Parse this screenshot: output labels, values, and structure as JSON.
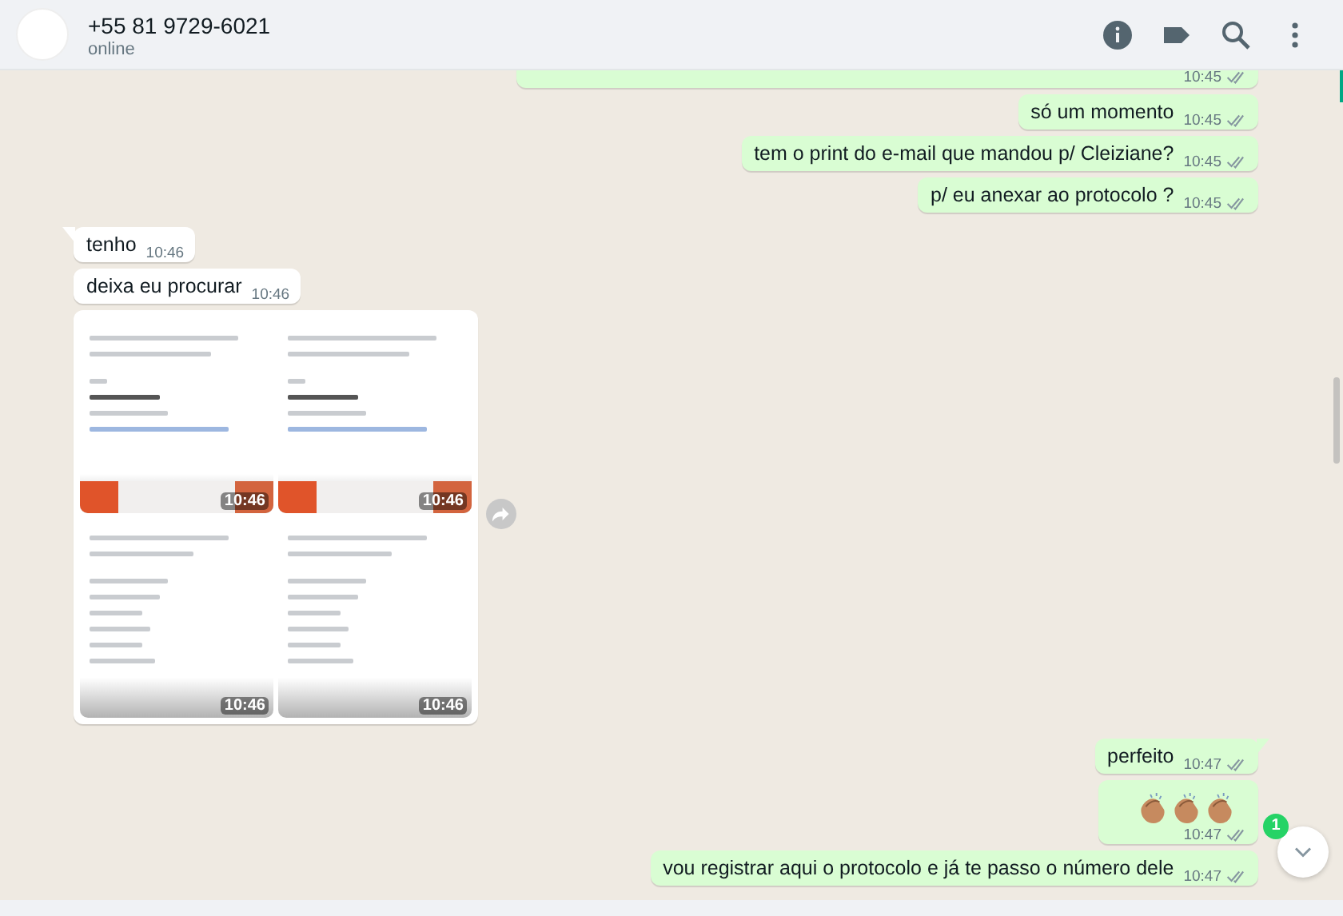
{
  "header": {
    "contact": "+55 81 9729-6021",
    "status": "online"
  },
  "messages": [
    {
      "kind": "cut",
      "outgoing": true,
      "time": "10:45",
      "read": false,
      "tail": false
    },
    {
      "kind": "text",
      "outgoing": true,
      "text": "só um momento",
      "time": "10:45",
      "read": false,
      "tail": false
    },
    {
      "kind": "text",
      "outgoing": true,
      "text": "tem o print do e-mail que mandou p/ Cleiziane?",
      "time": "10:45",
      "read": false,
      "tail": false
    },
    {
      "kind": "text",
      "outgoing": true,
      "text": "p/ eu anexar ao protocolo ?",
      "time": "10:45",
      "read": false,
      "tail": false
    },
    {
      "kind": "text",
      "outgoing": false,
      "text": "tenho",
      "time": "10:46",
      "tail": true
    },
    {
      "kind": "text",
      "outgoing": false,
      "text": "deixa eu procurar",
      "time": "10:46",
      "tail": false
    },
    {
      "kind": "images",
      "outgoing": false,
      "tail": false,
      "images": [
        {
          "kind": "banner",
          "time": "10:46"
        },
        {
          "kind": "banner",
          "time": "10:46"
        },
        {
          "kind": "table",
          "time": "10:46"
        },
        {
          "kind": "table",
          "time": "10:46"
        }
      ]
    },
    {
      "kind": "text",
      "outgoing": true,
      "text": "perfeito",
      "time": "10:47",
      "read": false,
      "tail": true
    },
    {
      "kind": "claps",
      "outgoing": true,
      "time": "10:47",
      "read": false,
      "tail": false
    },
    {
      "kind": "text",
      "outgoing": true,
      "text": "vou registrar aqui o protocolo e já te passo o número dele",
      "time": "10:47",
      "read": false,
      "tail": false
    }
  ],
  "scroll_button": {
    "badge": "1"
  }
}
